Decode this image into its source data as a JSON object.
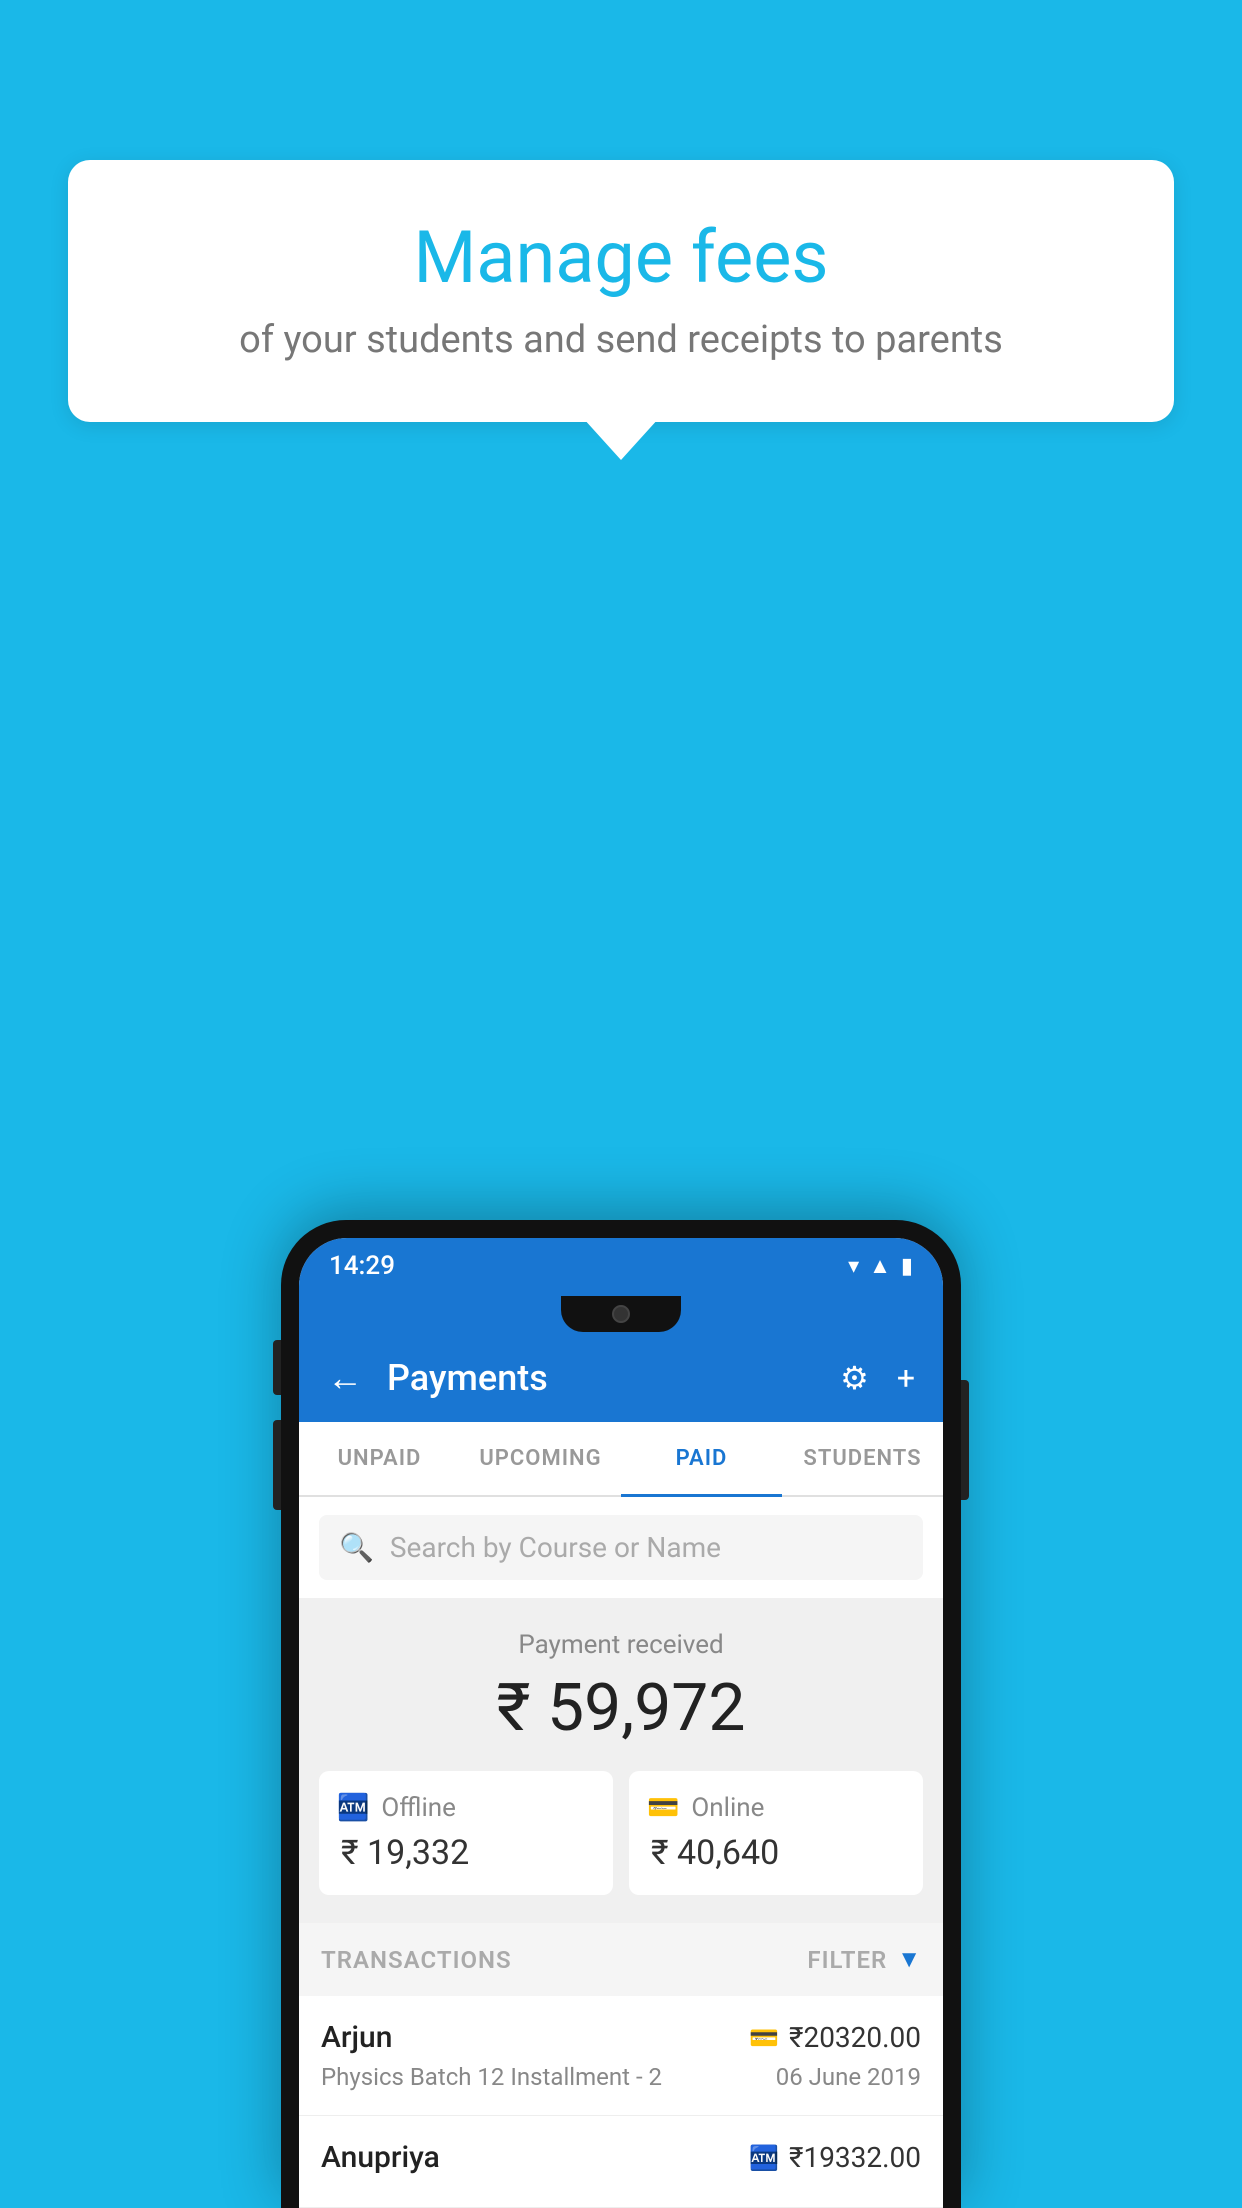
{
  "background_color": "#1ab8e8",
  "bubble": {
    "title": "Manage fees",
    "subtitle": "of your students and send receipts to parents"
  },
  "status_bar": {
    "time": "14:29",
    "wifi_icon": "▾",
    "signal_icon": "▲",
    "battery_icon": "▮"
  },
  "app_bar": {
    "title": "Payments",
    "back_icon": "←",
    "settings_icon": "⚙",
    "add_icon": "+"
  },
  "tabs": [
    {
      "label": "UNPAID",
      "active": false
    },
    {
      "label": "UPCOMING",
      "active": false
    },
    {
      "label": "PAID",
      "active": true
    },
    {
      "label": "STUDENTS",
      "active": false
    }
  ],
  "search": {
    "placeholder": "Search by Course or Name",
    "icon": "🔍"
  },
  "payment_summary": {
    "label": "Payment received",
    "total": "₹ 59,972",
    "offline": {
      "type": "Offline",
      "amount": "₹ 19,332"
    },
    "online": {
      "type": "Online",
      "amount": "₹ 40,640"
    }
  },
  "transactions": {
    "label": "TRANSACTIONS",
    "filter_label": "FILTER",
    "items": [
      {
        "name": "Arjun",
        "amount": "₹20320.00",
        "course": "Physics Batch 12 Installment - 2",
        "date": "06 June 2019",
        "type": "online"
      },
      {
        "name": "Anupriya",
        "amount": "₹19332.00",
        "course": "",
        "date": "",
        "type": "offline"
      }
    ]
  }
}
